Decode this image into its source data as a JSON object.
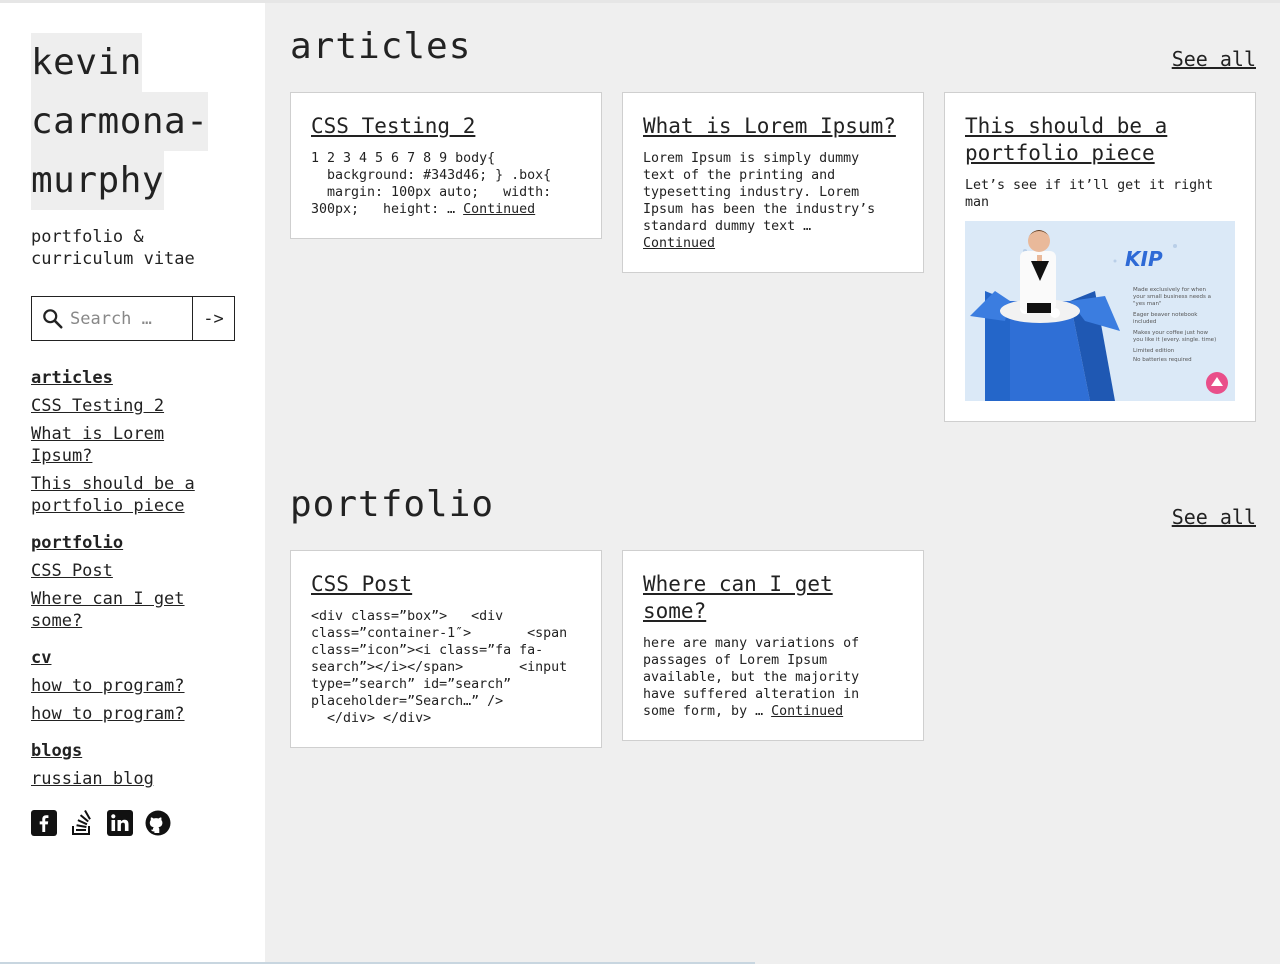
{
  "site": {
    "title_lines": [
      "kevin",
      "carmona-",
      "murphy"
    ],
    "tagline": "portfolio & curriculum vitae"
  },
  "search": {
    "placeholder": "Search …",
    "submit_label": "->"
  },
  "nav": {
    "articles": {
      "heading": "articles",
      "items": [
        "CSS Testing 2",
        "What is Lorem Ipsum?",
        "This should be a portfolio piece"
      ]
    },
    "portfolio": {
      "heading": "portfolio",
      "items": [
        "CSS Post",
        "Where can I get some?"
      ]
    },
    "cv": {
      "heading": "cv",
      "items": [
        "how to program?",
        "how to program?"
      ]
    },
    "blogs": {
      "heading": "blogs",
      "items": [
        "russian blog"
      ]
    }
  },
  "social": [
    "facebook-icon",
    "stackoverflow-icon",
    "linkedin-icon",
    "github-icon"
  ],
  "articles": {
    "heading": "articles",
    "see_all": "See all",
    "cards": [
      {
        "title": "CSS Testing 2",
        "excerpt": "1 2 3 4 5 6 7 8 9 body{\n  background: #343d46; } .box{\n  margin: 100px auto;   width:\n300px;   height: … ",
        "more": "Continued"
      },
      {
        "title": "What is Lorem Ipsum?",
        "excerpt": "Lorem Ipsum is simply dummy\ntext of the printing and\ntypesetting industry. Lorem\nIpsum has been the industry’s\nstandard dummy text … \n",
        "more": "Continued"
      },
      {
        "title": "This should be a portfolio piece",
        "excerpt": "Let’s see if it’ll get it right\nman",
        "more": ""
      }
    ]
  },
  "thumbnail": {
    "logo_text": "KIP",
    "bullets": [
      "Made exclusively for when",
      "your small business needs a",
      "\"yes man\"",
      "Eager beaver notebook",
      "included",
      "Makes your coffee just how",
      "you like it (every. single. time)",
      "Limited edition",
      "No batteries required"
    ]
  },
  "portfolio": {
    "heading": "portfolio",
    "see_all": "See all",
    "cards": [
      {
        "title": "CSS Post",
        "excerpt": "<div class=”box”>   <div\nclass=”container-1″>       <span\nclass=”icon”><i class=”fa fa-\nsearch”></i></span>       <input\ntype=”search” id=”search”\nplaceholder=”Search…” />\n  </div> </div>",
        "more": ""
      },
      {
        "title": "Where can I get some?",
        "excerpt": "here are many variations of\npassages of Lorem Ipsum\navailable, but the majority\nhave suffered alteration in\nsome form, by … ",
        "more": "Continued"
      }
    ]
  },
  "colors": {
    "sidebar_bg": "#ffffff",
    "page_bg": "#efefef",
    "text": "#222222",
    "thumb_bg": "#dbe9f7",
    "box_blue": "#2f6fd6",
    "badge_pink": "#e94f8a"
  }
}
